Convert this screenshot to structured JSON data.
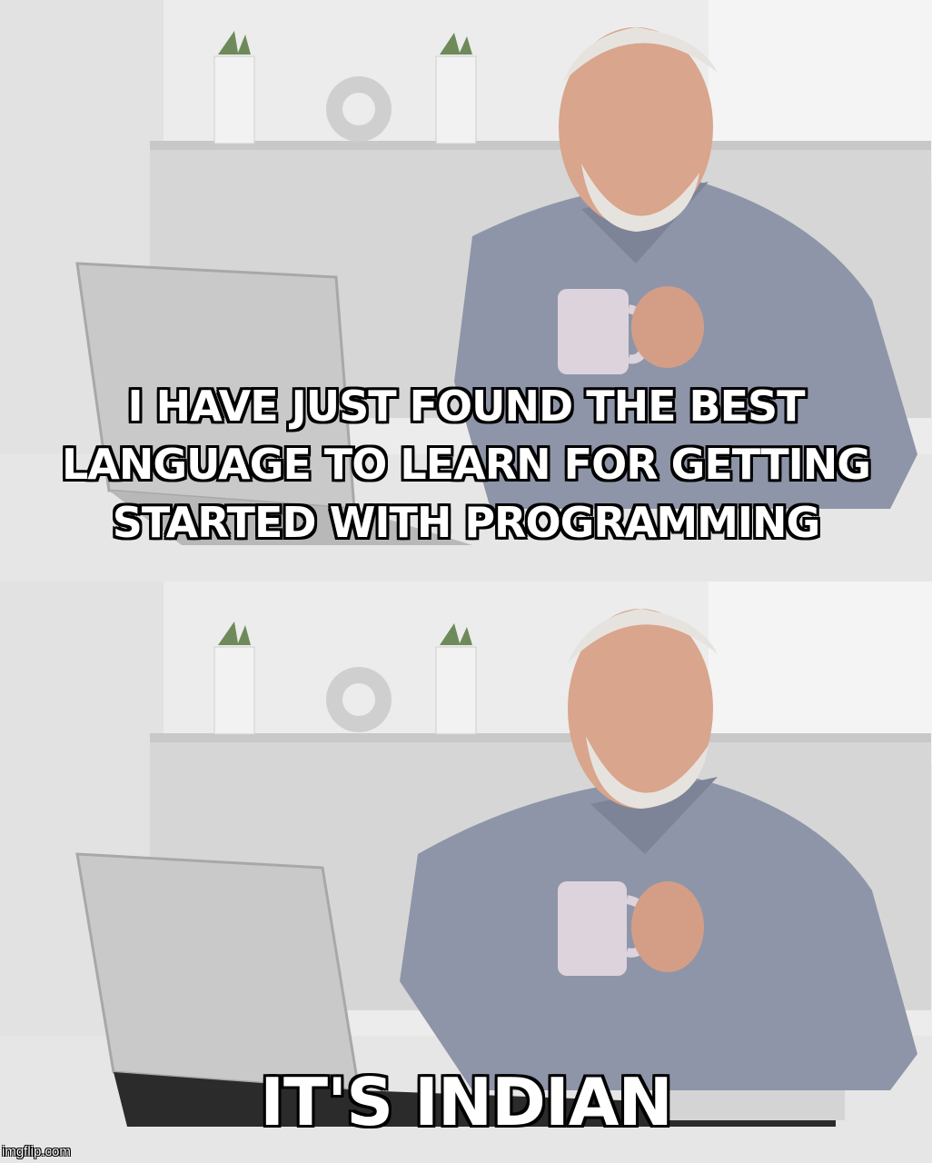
{
  "meme": {
    "top_caption": "I HAVE JUST FOUND THE BEST LANGUAGE TO LEARN FOR GETTING STARTED WITH PROGRAMMING",
    "bottom_caption": "IT'S INDIAN",
    "watermark": "imgflip.com"
  },
  "colors": {
    "wall": "#e8e8e8",
    "shirt": "#8e95a8",
    "skin": "#d9a58c",
    "hair": "#e6e3df",
    "laptop": "#c9c9c9",
    "mug": "#ddd3dd",
    "caption_text": "#ffffff",
    "caption_outline": "#000000"
  }
}
